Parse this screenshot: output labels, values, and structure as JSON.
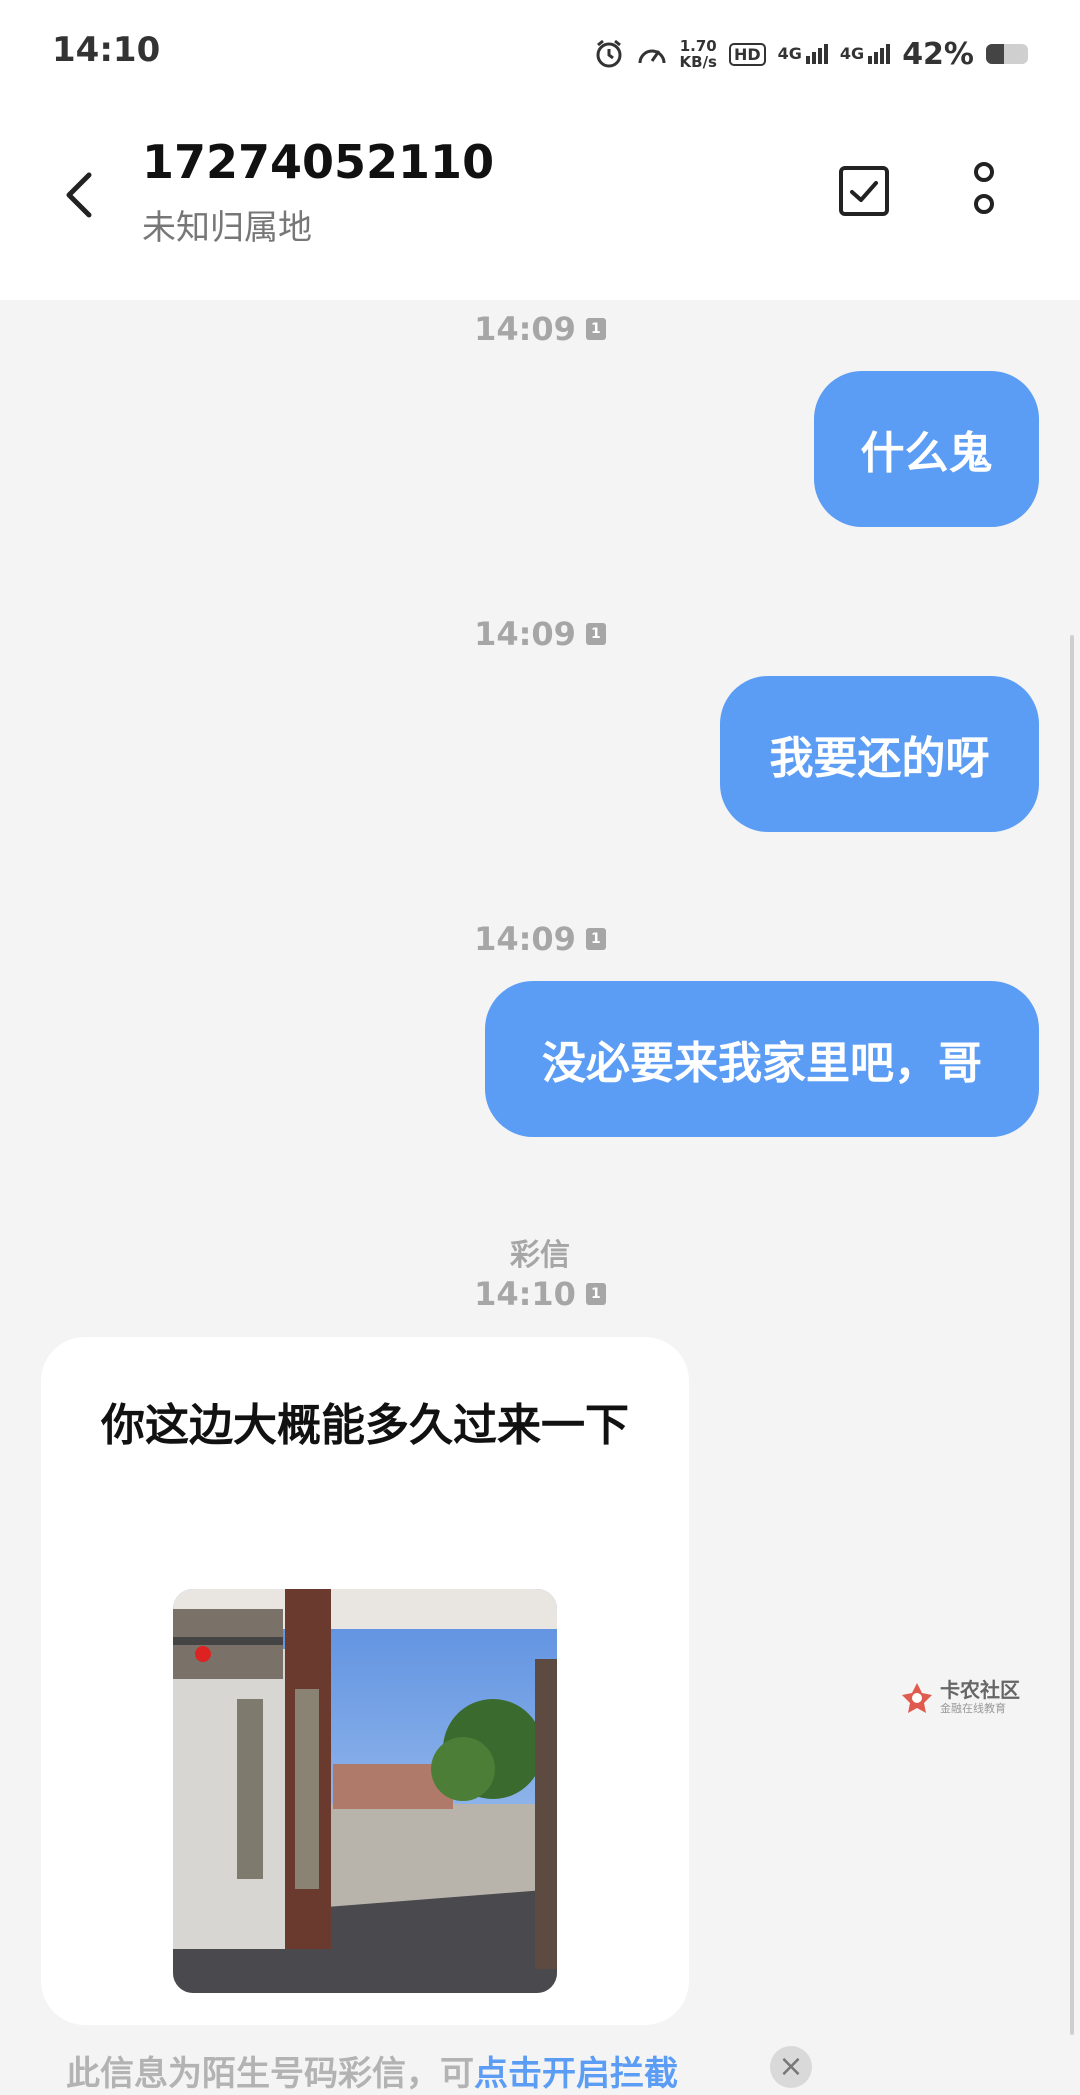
{
  "status_bar": {
    "time": "14:10",
    "speed_value": "1.70",
    "speed_unit": "KB/s",
    "hd_label": "HD",
    "net1_label": "4G",
    "net2_label": "4G",
    "battery_percent_text": "42%",
    "battery_level": 0.42,
    "icons": [
      "alarm-icon",
      "speedometer-icon",
      "hd-voice-icon",
      "signal-icon",
      "signal-icon",
      "battery-icon"
    ]
  },
  "header": {
    "contact_number": "17274052110",
    "contact_location": "未知归属地",
    "icons": [
      "back-arrow-icon",
      "select-checkbox-icon",
      "more-vertical-icon"
    ]
  },
  "messages": [
    {
      "time": "14:09",
      "sim": "1",
      "text": "什么鬼",
      "direction": "outgoing"
    },
    {
      "time": "14:09",
      "sim": "1",
      "text": "我要还的呀",
      "direction": "outgoing"
    },
    {
      "time": "14:09",
      "sim": "1",
      "text": "没必要来我家里吧，哥",
      "direction": "outgoing"
    },
    {
      "type_label": "彩信",
      "time": "14:10",
      "sim": "1",
      "text": "你这边大概能多久过来一下",
      "direction": "incoming",
      "has_image": true
    }
  ],
  "watermark": {
    "title": "卡农社区",
    "subtitle": "金融在线教育"
  },
  "notice": {
    "text": "此信息为陌生号码彩信，可",
    "link": "点击开启拦截"
  },
  "colors": {
    "outgoing_bubble": "#5b9cf5",
    "background": "#f4f4f4",
    "link": "#5b9cf5"
  }
}
